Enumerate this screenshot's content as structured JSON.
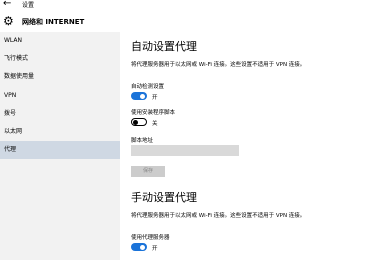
{
  "window": {
    "title": "设置"
  },
  "header": {
    "title": "网络和 INTERNET"
  },
  "sidebar": {
    "items": [
      {
        "label": "WLAN"
      },
      {
        "label": "飞行模式"
      },
      {
        "label": "数据使用量"
      },
      {
        "label": "VPN"
      },
      {
        "label": "拨号"
      },
      {
        "label": "以太网"
      },
      {
        "label": "代理"
      }
    ],
    "selected": "代理"
  },
  "auto_proxy": {
    "title": "自动设置代理",
    "description": "将代理服务器用于以太网或 Wi-Fi 连接。这些设置不适用于 VPN 连接。",
    "auto_detect": {
      "label": "自动检测设置",
      "state": "开",
      "on": true
    },
    "use_script": {
      "label": "使用安装程序脚本",
      "state": "关",
      "on": false
    },
    "script_address": {
      "label": "脚本地址",
      "value": ""
    },
    "save_label": "保存"
  },
  "manual_proxy": {
    "title": "手动设置代理",
    "description": "将代理服务器用于以太网或 Wi-Fi 连接。这些设置不适用于 VPN 连接。",
    "use_proxy": {
      "label": "使用代理服务器",
      "state": "开",
      "on": true
    }
  },
  "colors": {
    "accent": "#1a73d9",
    "selected_nav": "#cfd8e3",
    "sidebar_bg": "#f2f2f2"
  },
  "icons": {
    "back": "back-arrow-icon",
    "header": "gear-icon"
  }
}
